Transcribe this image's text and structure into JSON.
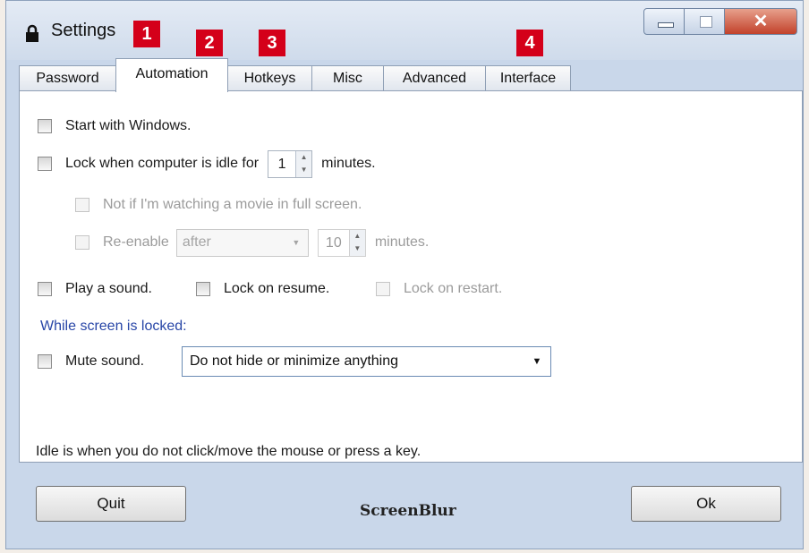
{
  "window": {
    "title": "Settings"
  },
  "annotations": [
    "1",
    "2",
    "3",
    "4"
  ],
  "tabs": [
    "Password",
    "Automation",
    "Hotkeys",
    "Misc",
    "Advanced",
    "Interface"
  ],
  "automation": {
    "start_with_windows": "Start with Windows.",
    "lock_idle_label": "Lock when computer is idle for",
    "idle_minutes": "1",
    "minutes_label": "minutes.",
    "not_if_movie": "Not if I'm watching a movie in full screen.",
    "reenable_label": "Re-enable",
    "reenable_select": "after",
    "reenable_minutes": "10",
    "reenable_minutes_label": "minutes.",
    "play_sound": "Play a sound.",
    "lock_on_resume": "Lock on resume.",
    "lock_on_restart": "Lock on restart.",
    "while_locked_label": "While screen is locked:",
    "mute_sound": "Mute sound.",
    "hide_select": "Do not hide or minimize anything",
    "idle_note": "Idle is when you do not click/move the mouse or press a key."
  },
  "footer": {
    "quit": "Quit",
    "brand": "ScreenBlur",
    "ok": "Ok"
  }
}
